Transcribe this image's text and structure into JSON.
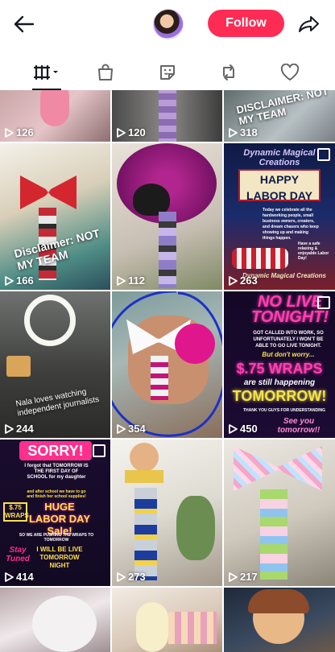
{
  "header": {
    "back_icon": "arrow-left-icon",
    "follow_label": "Follow",
    "share_icon": "share-arrow-icon",
    "accent": "#fe2c55"
  },
  "tabs": [
    {
      "name": "videos",
      "icon": "grid-icon"
    },
    {
      "name": "shop",
      "icon": "bag-icon"
    },
    {
      "name": "favorites",
      "icon": "sticker-icon"
    },
    {
      "name": "reposts",
      "icon": "repost-icon"
    },
    {
      "name": "liked",
      "icon": "heart-icon"
    }
  ],
  "posts": [
    {
      "views": "126"
    },
    {
      "views": "120"
    },
    {
      "views": "318",
      "overlay": "DISCLAIMER: NOT MY TEAM"
    },
    {
      "views": "166",
      "overlay": "Disclaimer: NOT MY TEAM"
    },
    {
      "views": "112"
    },
    {
      "views": "263",
      "brand": "Dynamic Magical Creations",
      "title": "HAPPY LABOR DAY",
      "body": "Today we celebrate all the hardworking people, small business owners, creators, and dream chasers who keep showing up and making things happen.",
      "side": "Have a safe relaxing & enjoyable Labor Day!",
      "footer": "Dynamic Magical Creations"
    },
    {
      "views": "244",
      "overlay": "Nala loves watching independent journalists"
    },
    {
      "views": "354"
    },
    {
      "views": "450",
      "title": "NO LIVE TONIGHT!",
      "body": "GOT CALLED INTO WORK, SO UNFORTUNATELY I WON'T BE ABLE TO GO LIVE TONIGHT.",
      "note": "But don't worry...",
      "price": "$.75 WRAPS",
      "sub": "are still happening",
      "big": "TOMORROW!",
      "thanks": "THANK YOU GUYS FOR UNDERSTANDING",
      "end": "See you tomorrow!!"
    },
    {
      "views": "414",
      "title": "SORRY!",
      "body": "I forgot that TOMORROW IS THE FIRST DAY OF SCHOOL for my daughter",
      "small": "and after school we have to go and finish her school supplies!",
      "price": "$.75 WRAPS",
      "promo": "HUGE LABOR DAY Sale!",
      "push": "SO WE ARE PUSHING THE WRAPS TO TOMORROW",
      "stay": "Stay Tuned",
      "live": "I WILL BE LIVE TOMORROW NIGHT"
    },
    {
      "views": "273"
    },
    {
      "views": "217"
    },
    {},
    {},
    {}
  ]
}
